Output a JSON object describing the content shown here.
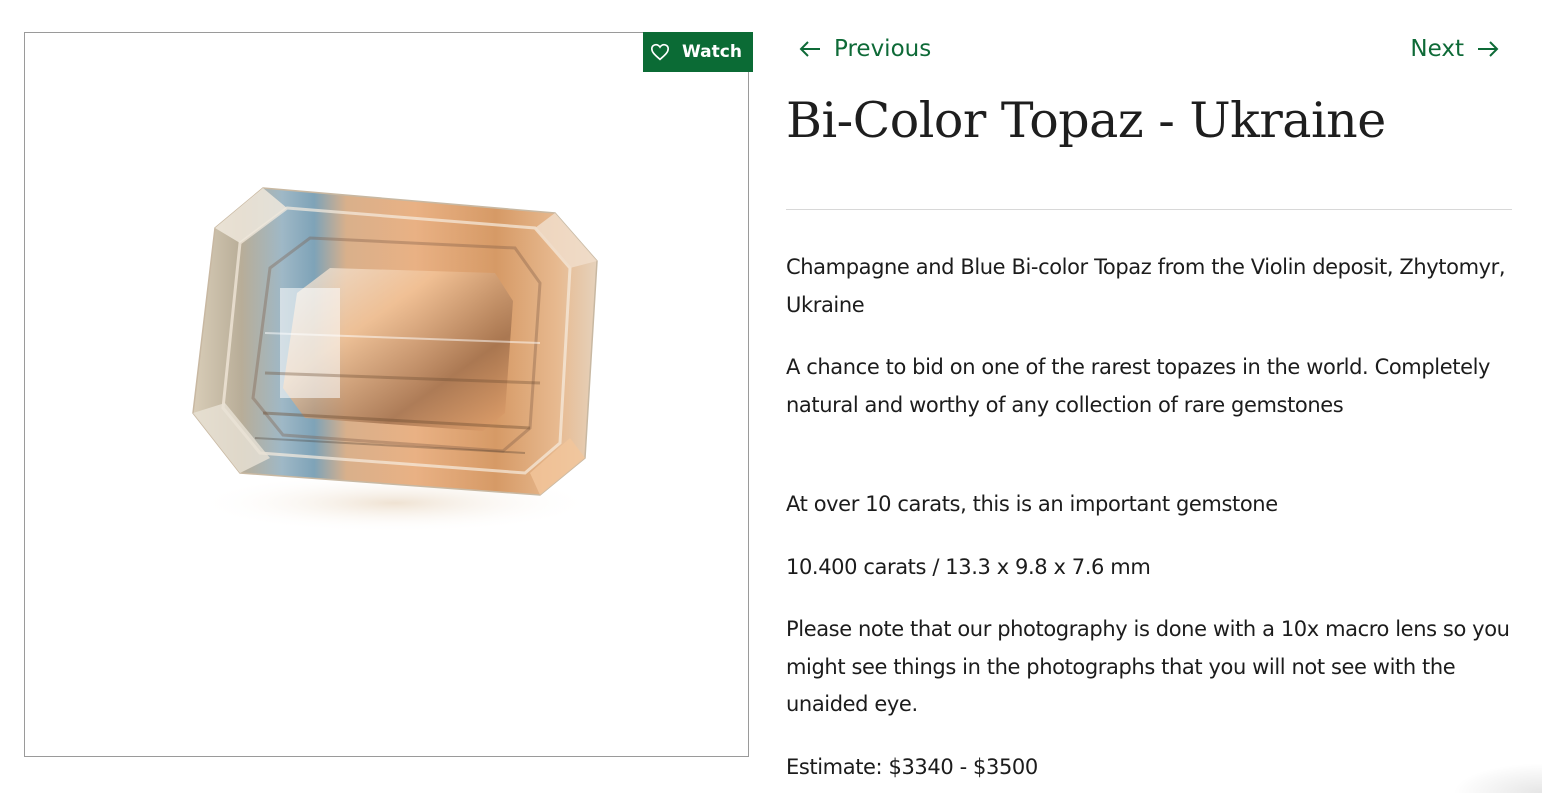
{
  "watch": {
    "label": "Watch",
    "icon": "heart-icon",
    "color": "#0b6b35"
  },
  "nav": {
    "previous_label": "Previous",
    "next_label": "Next",
    "color": "#0e6a37"
  },
  "product": {
    "title": "Bi-Color Topaz - Ukraine",
    "description": [
      "Champagne and Blue Bi-color Topaz from the Violin deposit, Zhytomyr, Ukraine",
      "A chance to bid on one of the rarest topazes in the world. Completely natural and worthy of any collection of rare gemstones",
      "At over 10 carats, this is an important gemstone",
      "10.400 carats / 13.3 x 9.8 x 7.6 mm",
      "Please note that our photography is done with a 10x macro lens so you might see things in the photographs that you will not see with the unaided eye.",
      "Estimate: $3340 - $3500"
    ]
  }
}
